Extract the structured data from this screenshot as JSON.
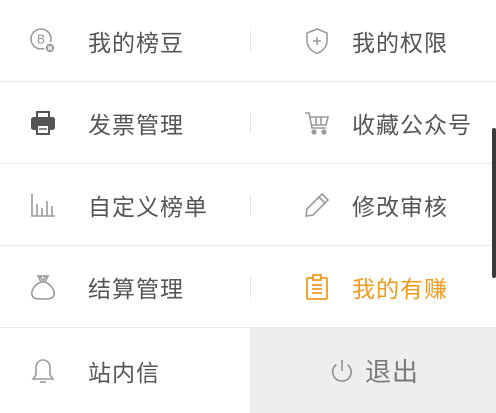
{
  "menu": {
    "items": [
      {
        "label": "我的榜豆",
        "icon": "coin-icon"
      },
      {
        "label": "我的权限",
        "icon": "shield-plus-icon"
      },
      {
        "label": "发票管理",
        "icon": "printer-icon"
      },
      {
        "label": "收藏公众号",
        "icon": "cart-icon"
      },
      {
        "label": "自定义榜单",
        "icon": "bar-chart-icon"
      },
      {
        "label": "修改审核",
        "icon": "pencil-icon"
      },
      {
        "label": "结算管理",
        "icon": "money-bag-icon"
      },
      {
        "label": "我的有赚",
        "icon": "clipboard-icon"
      },
      {
        "label": "站内信",
        "icon": "bell-icon"
      }
    ],
    "active_index": 7,
    "logout": {
      "label": "退出",
      "icon": "power-icon"
    }
  },
  "colors": {
    "text": "#555555",
    "icon": "#9a9a9a",
    "active": "#f29a1f",
    "logout_bg": "#eeeeee",
    "border": "#ececec"
  }
}
